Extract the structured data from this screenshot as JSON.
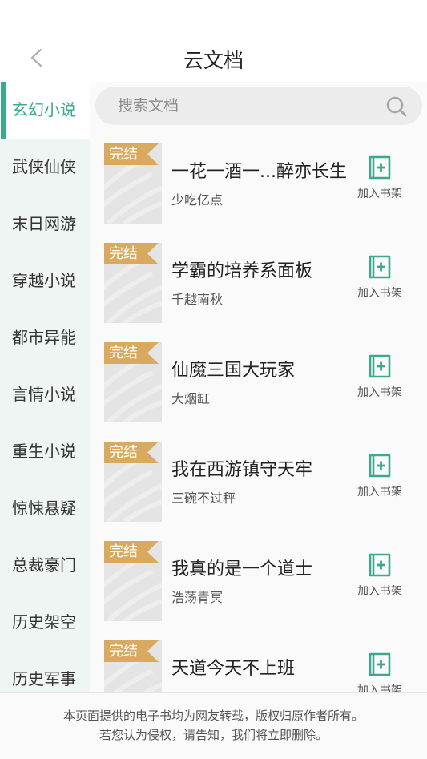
{
  "header": {
    "title": "云文档"
  },
  "search": {
    "placeholder": "搜索文档"
  },
  "categories": [
    {
      "label": "玄幻小说",
      "active": true
    },
    {
      "label": "武侠仙侠"
    },
    {
      "label": "末日网游"
    },
    {
      "label": "穿越小说"
    },
    {
      "label": "都市异能"
    },
    {
      "label": "言情小说"
    },
    {
      "label": "重生小说"
    },
    {
      "label": "惊悚悬疑"
    },
    {
      "label": "总裁豪门"
    },
    {
      "label": "历史架空"
    },
    {
      "label": "历史军事"
    }
  ],
  "books": [
    {
      "title": "一花一酒一...醉亦长生",
      "author": "少吃亿点",
      "badge": "完结",
      "add_label": "加入书架"
    },
    {
      "title": "学霸的培养系面板",
      "author": "千越南秋",
      "badge": "完结",
      "add_label": "加入书架"
    },
    {
      "title": "仙魔三国大玩家",
      "author": "大烟缸",
      "badge": "完结",
      "add_label": "加入书架"
    },
    {
      "title": "我在西游镇守天牢",
      "author": "三碗不过秤",
      "badge": "完结",
      "add_label": "加入书架"
    },
    {
      "title": "我真的是一个道士",
      "author": "浩荡青冥",
      "badge": "完结",
      "add_label": "加入书架"
    },
    {
      "title": "天道今天不上班",
      "author": "",
      "badge": "完结",
      "add_label": "加入书架"
    }
  ],
  "footer": {
    "line1": "本页面提供的电子书均为网友转载，版权归原作者所有。",
    "line2": "若您认为侵权，请告知，我们将立即删除。"
  },
  "colors": {
    "accent": "#3ca88c",
    "badge": "#d9a95f",
    "sidebar_bg": "#eef5f2"
  },
  "icons": {
    "back": "chevron-left-icon",
    "search": "search-icon",
    "add": "add-to-shelf-icon"
  }
}
